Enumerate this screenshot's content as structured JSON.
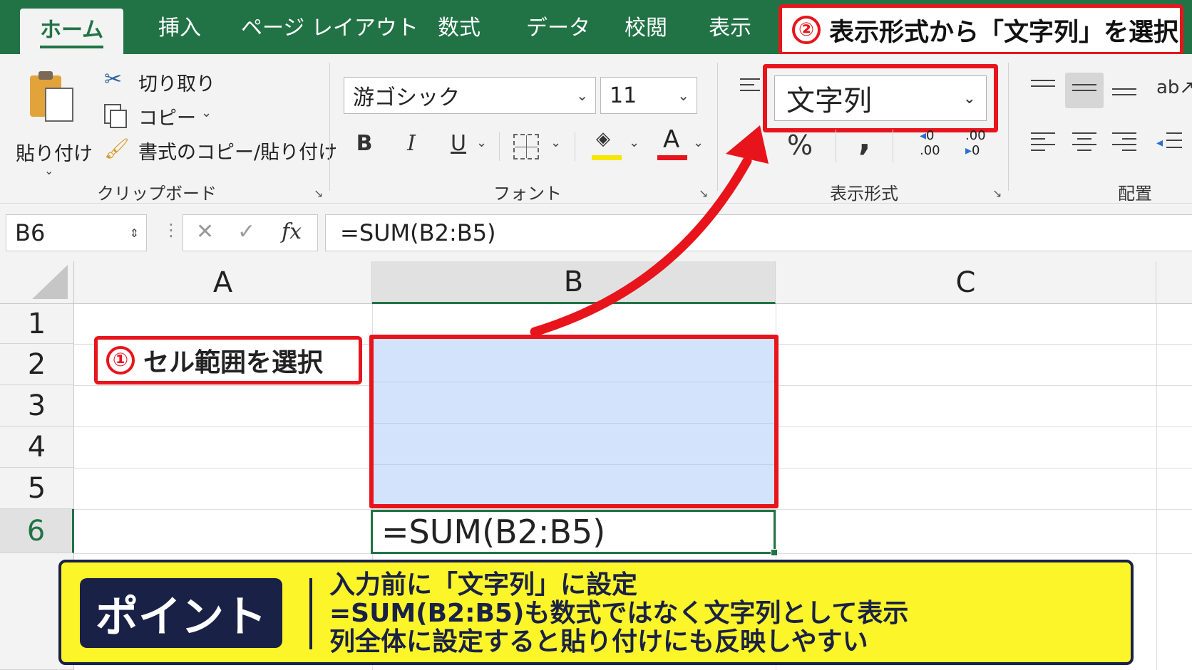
{
  "tabs": [
    {
      "label": "ホーム",
      "active": true
    },
    {
      "label": "挿入"
    },
    {
      "label": "ページ レイアウト"
    },
    {
      "label": "数式"
    },
    {
      "label": "データ"
    },
    {
      "label": "校閲"
    },
    {
      "label": "表示"
    }
  ],
  "annotations": {
    "step2_num": "②",
    "step2_text": "表示形式から「文字列」を選択",
    "step1_num": "①",
    "step1_text": "セル範囲を選択"
  },
  "clipboard": {
    "paste_label": "貼り付け",
    "cut_label": "切り取り",
    "copy_label": "コピー",
    "format_painter_label": "書式のコピー/貼り付け",
    "group_label": "クリップボード"
  },
  "font": {
    "font_name": "游ゴシック",
    "font_size": "11",
    "bold": "B",
    "italic": "I",
    "underline": "U",
    "font_color_glyph": "A",
    "group_label": "フォント"
  },
  "number_format": {
    "value": "文字列",
    "percent": "%",
    "comma": ",",
    "inc_top": "0",
    "inc_bottom": ".00",
    "dec_top": ".00",
    "dec_bottom": "0",
    "group_label": "表示形式"
  },
  "alignment": {
    "group_label": "配置"
  },
  "formula_bar": {
    "name_box": "B6",
    "cancel_glyph": "✕",
    "enter_glyph": "✓",
    "fx_glyph": "fx",
    "formula": "=SUM(B2:B5)"
  },
  "sheet": {
    "columns": [
      "A",
      "B",
      "C"
    ],
    "rows": [
      "1",
      "2",
      "3",
      "4",
      "5",
      "6"
    ],
    "selected_column": "B",
    "selected_row": "6",
    "b6_value": "=SUM(B2:B5)"
  },
  "point": {
    "badge": "ポイント",
    "lines": [
      "入力前に「文字列」に設定",
      "=SUM(B2:B5)も数式ではなく文字列として表示",
      "列全体に設定すると貼り付けにも反映しやすい"
    ]
  },
  "colors": {
    "excel_green": "#217346",
    "highlight_red": "#e8141c",
    "selection_blue": "#d2e3fb",
    "point_yellow": "#fbf52a",
    "point_navy": "#1a2147"
  }
}
